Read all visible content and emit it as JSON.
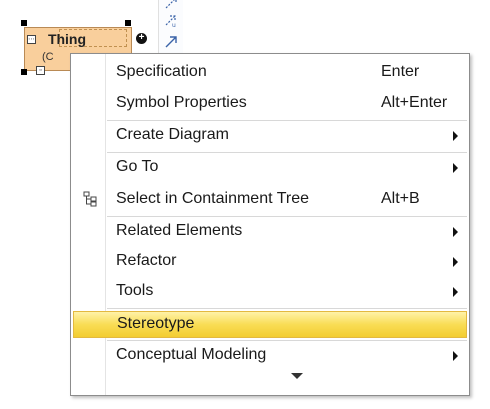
{
  "diagram": {
    "element_name": "Thing",
    "element_subtitle": "(C"
  },
  "context_menu": {
    "items": [
      {
        "label": "Specification",
        "shortcut": "Enter"
      },
      {
        "label": "Symbol Properties",
        "shortcut": "Alt+Enter"
      },
      {
        "label": "Create Diagram",
        "submenu": true
      },
      {
        "label": "Go To",
        "submenu": true
      },
      {
        "label": "Select in Containment Tree",
        "shortcut": "Alt+B",
        "icon": "containment-tree-icon"
      },
      {
        "label": "Related Elements",
        "submenu": true
      },
      {
        "label": "Refactor",
        "submenu": true
      },
      {
        "label": "Tools",
        "submenu": true
      },
      {
        "label": "Stereotype",
        "highlighted": true
      },
      {
        "label": "Conceptual Modeling",
        "submenu": true
      }
    ],
    "highlight_color": "#f9dd55"
  }
}
